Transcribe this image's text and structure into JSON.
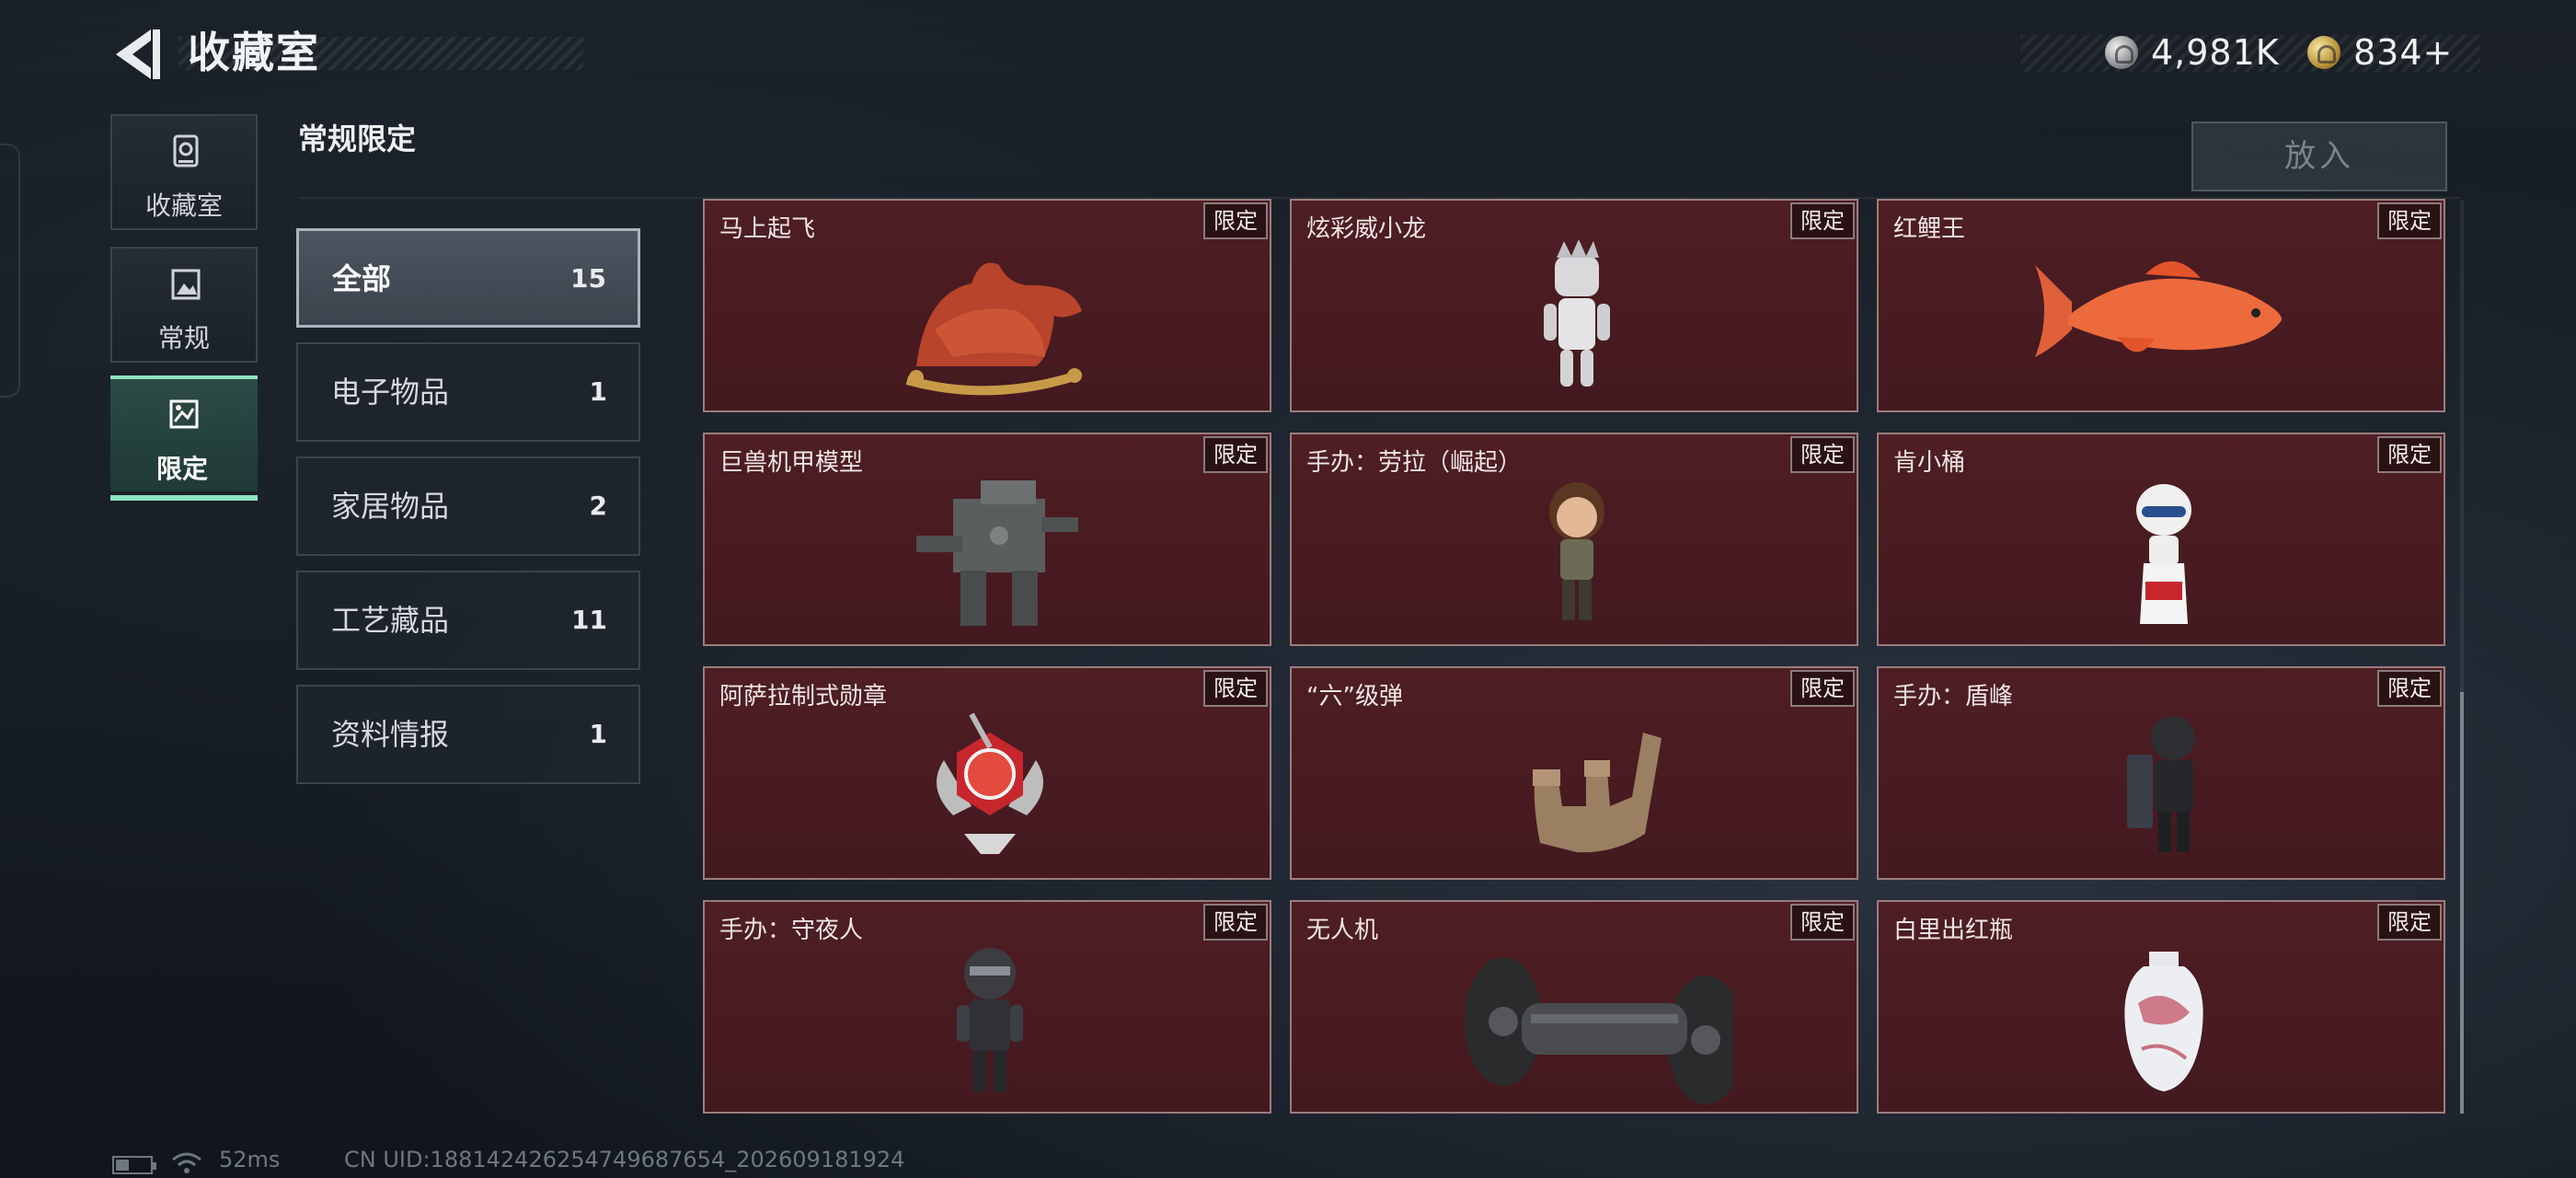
{
  "header": {
    "title": "收藏室",
    "currency": [
      {
        "icon": "silver-coin-icon",
        "value": "4,981K"
      },
      {
        "icon": "gold-coin-icon",
        "value": "834+"
      }
    ]
  },
  "nav_tabs": [
    {
      "label": "收藏室",
      "icon": "collection-room-icon",
      "active": false
    },
    {
      "label": "常规",
      "icon": "regular-icon",
      "active": false
    },
    {
      "label": "限定",
      "icon": "limited-icon",
      "active": true
    }
  ],
  "section_title": "常规限定",
  "put_in_label": "放入",
  "categories": [
    {
      "label": "全部",
      "count": "15",
      "active": true
    },
    {
      "label": "电子物品",
      "count": "1",
      "active": false
    },
    {
      "label": "家居物品",
      "count": "2",
      "active": false
    },
    {
      "label": "工艺藏品",
      "count": "11",
      "active": false
    },
    {
      "label": "资料情报",
      "count": "1",
      "active": false
    }
  ],
  "items": [
    {
      "name": "马上起飞",
      "badge": "限定",
      "icon": "rocking-horse-icon"
    },
    {
      "name": "炫彩威小龙",
      "badge": "限定",
      "icon": "dragon-figure-icon"
    },
    {
      "name": "红鲤王",
      "badge": "限定",
      "icon": "red-carp-icon"
    },
    {
      "name": "巨兽机甲模型",
      "badge": "限定",
      "icon": "mech-model-icon"
    },
    {
      "name": "手办：劳拉（崛起）",
      "badge": "限定",
      "icon": "lara-figure-icon"
    },
    {
      "name": "肯小桶",
      "badge": "限定",
      "icon": "colonel-figure-icon"
    },
    {
      "name": "阿萨拉制式勋章",
      "badge": "限定",
      "icon": "medal-icon"
    },
    {
      "name": "“六”级弹",
      "badge": "限定",
      "icon": "six-hand-bullets-icon"
    },
    {
      "name": "手办：盾峰",
      "badge": "限定",
      "icon": "shield-soldier-figure-icon"
    },
    {
      "name": "手办：守夜人",
      "badge": "限定",
      "icon": "night-watch-figure-icon"
    },
    {
      "name": "无人机",
      "badge": "限定",
      "icon": "drone-icon"
    },
    {
      "name": "白里出红瓶",
      "badge": "限定",
      "icon": "porcelain-vase-icon"
    }
  ],
  "footer": {
    "ping": "52ms",
    "uid": "CN UID:188142426254749687654_202609181924"
  },
  "colors": {
    "accent": "#8ee3c1",
    "card_bg": "#4e1e24",
    "card_border": "#9a7d7f"
  }
}
